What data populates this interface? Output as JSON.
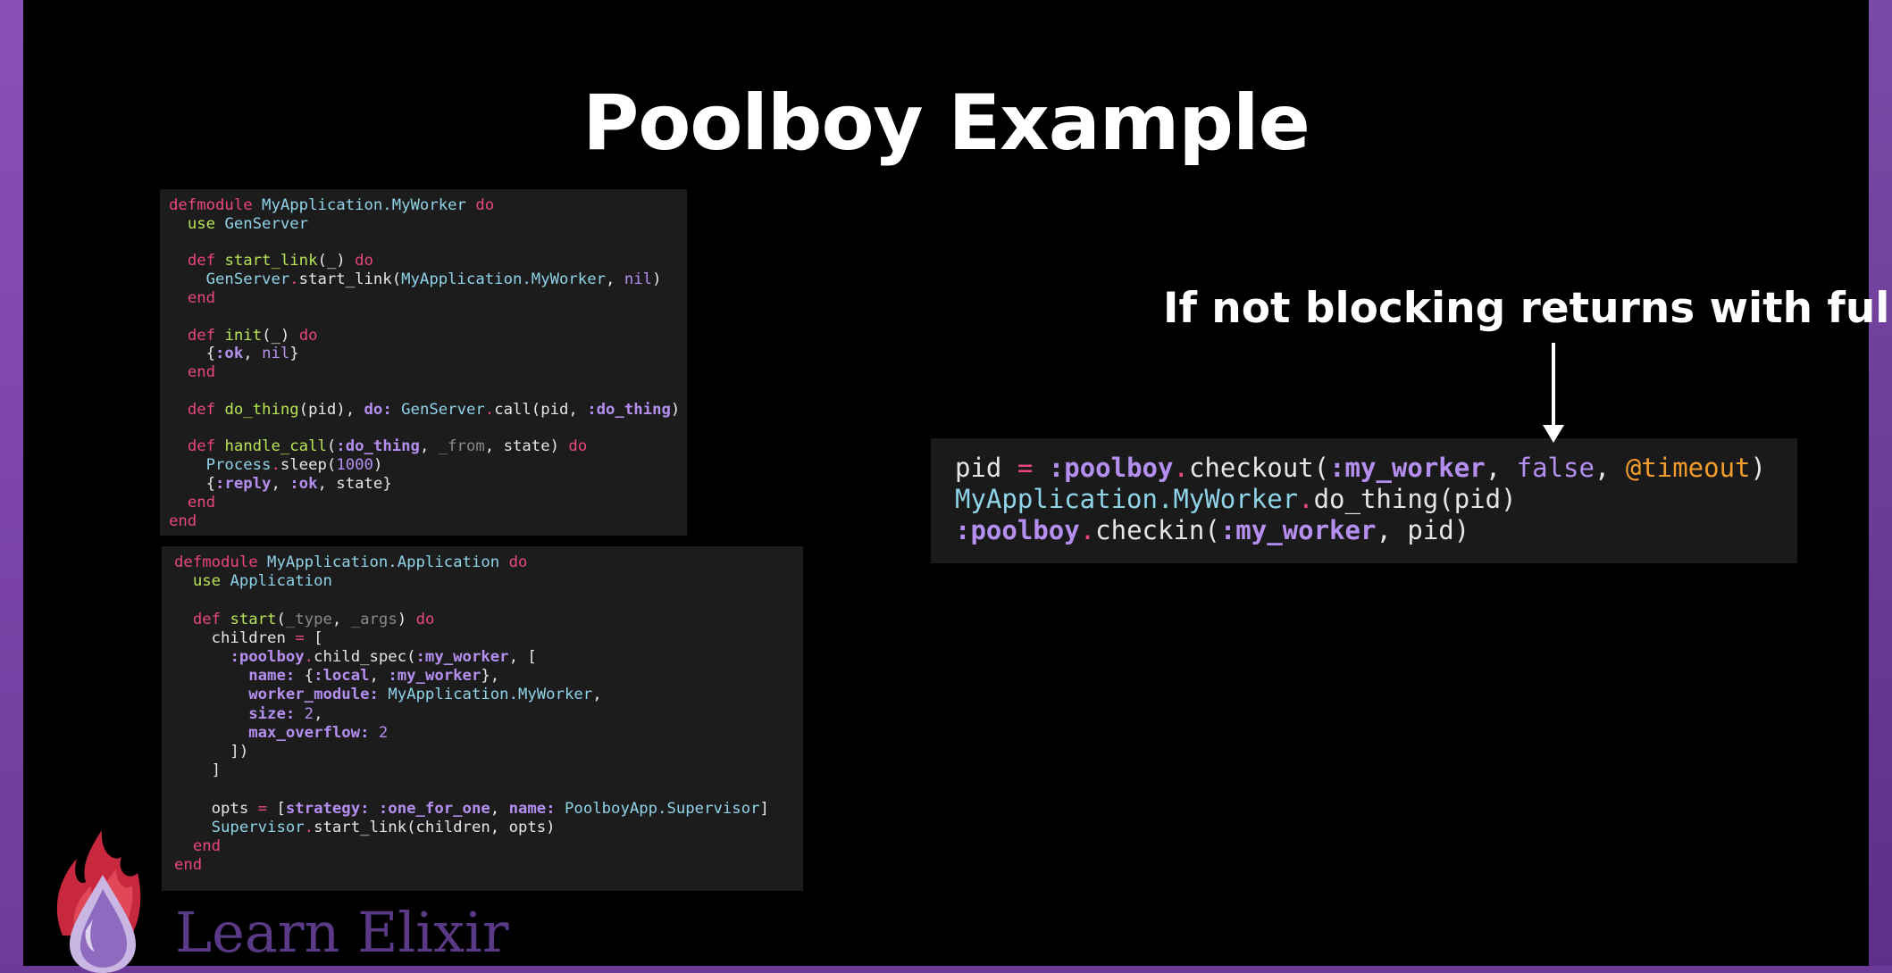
{
  "slide": {
    "title": "Poolboy Example",
    "annotation": "If not blocking returns with full",
    "brand": "Learn Elixir"
  },
  "worker_code": [
    [
      {
        "t": "defmodule",
        "c": "kw"
      },
      {
        "t": " "
      },
      {
        "t": "MyApplication.MyWorker",
        "c": "mod"
      },
      {
        "t": " "
      },
      {
        "t": "do",
        "c": "kw"
      }
    ],
    [
      {
        "t": "  "
      },
      {
        "t": "use",
        "c": "fn"
      },
      {
        "t": " "
      },
      {
        "t": "GenServer",
        "c": "mod"
      }
    ],
    [],
    [
      {
        "t": "  "
      },
      {
        "t": "def",
        "c": "kw"
      },
      {
        "t": " "
      },
      {
        "t": "start_link",
        "c": "fn"
      },
      {
        "t": "(_) "
      },
      {
        "t": "do",
        "c": "kw"
      }
    ],
    [
      {
        "t": "    "
      },
      {
        "t": "GenServer",
        "c": "mod"
      },
      {
        "t": ".",
        "c": "kw"
      },
      {
        "t": "start_link("
      },
      {
        "t": "MyApplication.MyWorker",
        "c": "mod"
      },
      {
        "t": ", "
      },
      {
        "t": "nil",
        "c": "num"
      },
      {
        "t": ")"
      }
    ],
    [
      {
        "t": "  "
      },
      {
        "t": "end",
        "c": "kw"
      }
    ],
    [],
    [
      {
        "t": "  "
      },
      {
        "t": "def",
        "c": "kw"
      },
      {
        "t": " "
      },
      {
        "t": "init",
        "c": "fn"
      },
      {
        "t": "(_) "
      },
      {
        "t": "do",
        "c": "kw"
      }
    ],
    [
      {
        "t": "    {"
      },
      {
        "t": ":ok",
        "c": "atom"
      },
      {
        "t": ", "
      },
      {
        "t": "nil",
        "c": "num"
      },
      {
        "t": "}"
      }
    ],
    [
      {
        "t": "  "
      },
      {
        "t": "end",
        "c": "kw"
      }
    ],
    [],
    [
      {
        "t": "  "
      },
      {
        "t": "def",
        "c": "kw"
      },
      {
        "t": " "
      },
      {
        "t": "do_thing",
        "c": "fn"
      },
      {
        "t": "(pid), "
      },
      {
        "t": "do:",
        "c": "atom"
      },
      {
        "t": " "
      },
      {
        "t": "GenServer",
        "c": "mod"
      },
      {
        "t": ".",
        "c": "kw"
      },
      {
        "t": "call(pid, "
      },
      {
        "t": ":do_thing",
        "c": "atom"
      },
      {
        "t": ")"
      }
    ],
    [],
    [
      {
        "t": "  "
      },
      {
        "t": "def",
        "c": "kw"
      },
      {
        "t": " "
      },
      {
        "t": "handle_call",
        "c": "fn"
      },
      {
        "t": "("
      },
      {
        "t": ":do_thing",
        "c": "atom"
      },
      {
        "t": ", "
      },
      {
        "t": "_from",
        "c": "cm"
      },
      {
        "t": ", state) "
      },
      {
        "t": "do",
        "c": "kw"
      }
    ],
    [
      {
        "t": "    "
      },
      {
        "t": "Process",
        "c": "mod"
      },
      {
        "t": ".",
        "c": "kw"
      },
      {
        "t": "sleep("
      },
      {
        "t": "1000",
        "c": "num"
      },
      {
        "t": ")"
      }
    ],
    [
      {
        "t": "    {"
      },
      {
        "t": ":reply",
        "c": "atom"
      },
      {
        "t": ", "
      },
      {
        "t": ":ok",
        "c": "atom"
      },
      {
        "t": ", state}"
      }
    ],
    [
      {
        "t": "  "
      },
      {
        "t": "end",
        "c": "kw"
      }
    ],
    [
      {
        "t": "end",
        "c": "kw"
      }
    ]
  ],
  "app_code": [
    [
      {
        "t": "defmodule",
        "c": "kw"
      },
      {
        "t": " "
      },
      {
        "t": "MyApplication.Application",
        "c": "mod"
      },
      {
        "t": " "
      },
      {
        "t": "do",
        "c": "kw"
      }
    ],
    [
      {
        "t": "  "
      },
      {
        "t": "use",
        "c": "fn"
      },
      {
        "t": " "
      },
      {
        "t": "Application",
        "c": "mod"
      }
    ],
    [],
    [
      {
        "t": "  "
      },
      {
        "t": "def",
        "c": "kw"
      },
      {
        "t": " "
      },
      {
        "t": "start",
        "c": "fn"
      },
      {
        "t": "("
      },
      {
        "t": "_type",
        "c": "cm"
      },
      {
        "t": ", "
      },
      {
        "t": "_args",
        "c": "cm"
      },
      {
        "t": ") "
      },
      {
        "t": "do",
        "c": "kw"
      }
    ],
    [
      {
        "t": "    children "
      },
      {
        "t": "=",
        "c": "kw"
      },
      {
        "t": " ["
      }
    ],
    [
      {
        "t": "      "
      },
      {
        "t": ":poolboy",
        "c": "atom"
      },
      {
        "t": ".",
        "c": "kw"
      },
      {
        "t": "child_spec("
      },
      {
        "t": ":my_worker",
        "c": "atom"
      },
      {
        "t": ", ["
      }
    ],
    [
      {
        "t": "        "
      },
      {
        "t": "name:",
        "c": "atom"
      },
      {
        "t": " {"
      },
      {
        "t": ":local",
        "c": "atom"
      },
      {
        "t": ", "
      },
      {
        "t": ":my_worker",
        "c": "atom"
      },
      {
        "t": "},"
      }
    ],
    [
      {
        "t": "        "
      },
      {
        "t": "worker_module:",
        "c": "atom"
      },
      {
        "t": " "
      },
      {
        "t": "MyApplication.MyWorker",
        "c": "mod"
      },
      {
        "t": ","
      }
    ],
    [
      {
        "t": "        "
      },
      {
        "t": "size:",
        "c": "atom"
      },
      {
        "t": " "
      },
      {
        "t": "2",
        "c": "num"
      },
      {
        "t": ","
      }
    ],
    [
      {
        "t": "        "
      },
      {
        "t": "max_overflow:",
        "c": "atom"
      },
      {
        "t": " "
      },
      {
        "t": "2",
        "c": "num"
      }
    ],
    [
      {
        "t": "      ])"
      }
    ],
    [
      {
        "t": "    ]"
      }
    ],
    [],
    [
      {
        "t": "    opts "
      },
      {
        "t": "=",
        "c": "kw"
      },
      {
        "t": " ["
      },
      {
        "t": "strategy:",
        "c": "atom"
      },
      {
        "t": " "
      },
      {
        "t": ":one_for_one",
        "c": "atom"
      },
      {
        "t": ", "
      },
      {
        "t": "name:",
        "c": "atom"
      },
      {
        "t": " "
      },
      {
        "t": "PoolboyApp.Supervisor",
        "c": "mod"
      },
      {
        "t": "]"
      }
    ],
    [
      {
        "t": "    "
      },
      {
        "t": "Supervisor",
        "c": "mod"
      },
      {
        "t": ".",
        "c": "kw"
      },
      {
        "t": "start_link(children, opts)"
      }
    ],
    [
      {
        "t": "  "
      },
      {
        "t": "end",
        "c": "kw"
      }
    ],
    [
      {
        "t": "end",
        "c": "kw"
      }
    ]
  ],
  "checkout_code": [
    [
      {
        "t": "pid "
      },
      {
        "t": "=",
        "c": "kw"
      },
      {
        "t": " "
      },
      {
        "t": ":poolboy",
        "c": "atom"
      },
      {
        "t": ".",
        "c": "kw"
      },
      {
        "t": "checkout("
      },
      {
        "t": ":my_worker",
        "c": "atom"
      },
      {
        "t": ", "
      },
      {
        "t": "false",
        "c": "bool"
      },
      {
        "t": ", "
      },
      {
        "t": "@timeout",
        "c": "attr"
      },
      {
        "t": ")"
      }
    ],
    [
      {
        "t": "MyApplication.MyWorker",
        "c": "mod"
      },
      {
        "t": ".",
        "c": "kw"
      },
      {
        "t": "do_thing(pid)"
      }
    ],
    [
      {
        "t": ":poolboy",
        "c": "atom"
      },
      {
        "t": ".",
        "c": "kw"
      },
      {
        "t": "checkin("
      },
      {
        "t": ":my_worker",
        "c": "atom"
      },
      {
        "t": ", pid)"
      }
    ]
  ],
  "colors": {
    "frame": "#7a4aa8",
    "keyword": "#e8467c",
    "module": "#8fd3e8",
    "function": "#b6e354",
    "atom": "#b58ff0",
    "attribute": "#f39c2b",
    "brand": "#5a3a86"
  },
  "icons": {
    "logo": "elixir-flame-drop-icon",
    "arrow": "down-arrow-icon"
  }
}
